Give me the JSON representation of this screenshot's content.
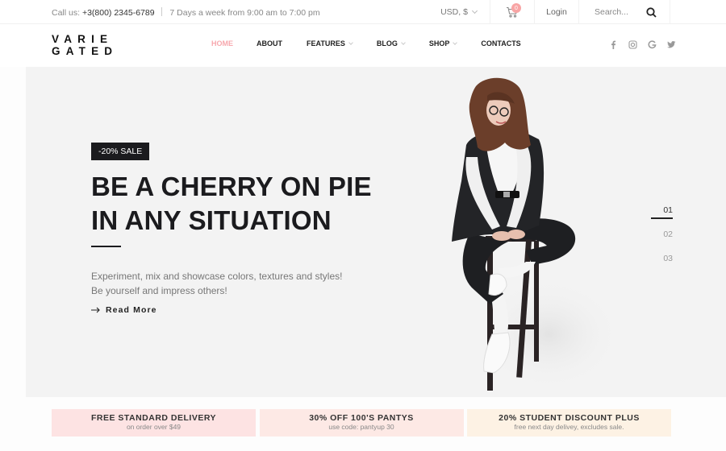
{
  "topbar": {
    "call_label": "Call us:",
    "phone": "+3(800) 2345-6789",
    "hours": "7 Days a week from 9:00 am to 7:00 pm",
    "currency": "USD, $",
    "cart_count": "0",
    "login_label": "Login",
    "search_placeholder": "Search..."
  },
  "header": {
    "logo_line1": "VARIE",
    "logo_line2": "GATED",
    "nav": [
      {
        "label": "HOME",
        "active": true,
        "dropdown": false
      },
      {
        "label": "ABOUT",
        "active": false,
        "dropdown": false
      },
      {
        "label": "FEATURES",
        "active": false,
        "dropdown": true
      },
      {
        "label": "BLOG",
        "active": false,
        "dropdown": true
      },
      {
        "label": "SHOP",
        "active": false,
        "dropdown": true
      },
      {
        "label": "CONTACTS",
        "active": false,
        "dropdown": false
      }
    ],
    "social": [
      "facebook",
      "instagram",
      "google",
      "twitter"
    ]
  },
  "hero": {
    "badge": "-20% SALE",
    "headline_line1": "BE A CHERRY ON PIE",
    "headline_line2": "IN ANY SITUATION",
    "desc_line1": "Experiment, mix and showcase colors, textures and styles!",
    "desc_line2": "Be yourself and impress others!",
    "cta": "Read More",
    "slides": [
      "01",
      "02",
      "03"
    ],
    "active_slide": "01"
  },
  "promos": [
    {
      "title": "FREE STANDARD DELIVERY",
      "subtitle": "on order over $49",
      "color": "#fde3e3"
    },
    {
      "title": "30% OFF 100'S PANTYS",
      "subtitle": "use code: pantyup 30",
      "color": "#fde9e5"
    },
    {
      "title": "20% STUDENT DISCOUNT PLUS",
      "subtitle": "free next day delivey, excludes sale.",
      "color": "#fdf2e4"
    }
  ],
  "colors": {
    "accent": "#f7a8ae",
    "dark": "#1b1b1e",
    "hero_bg": "#f3f3f3"
  }
}
